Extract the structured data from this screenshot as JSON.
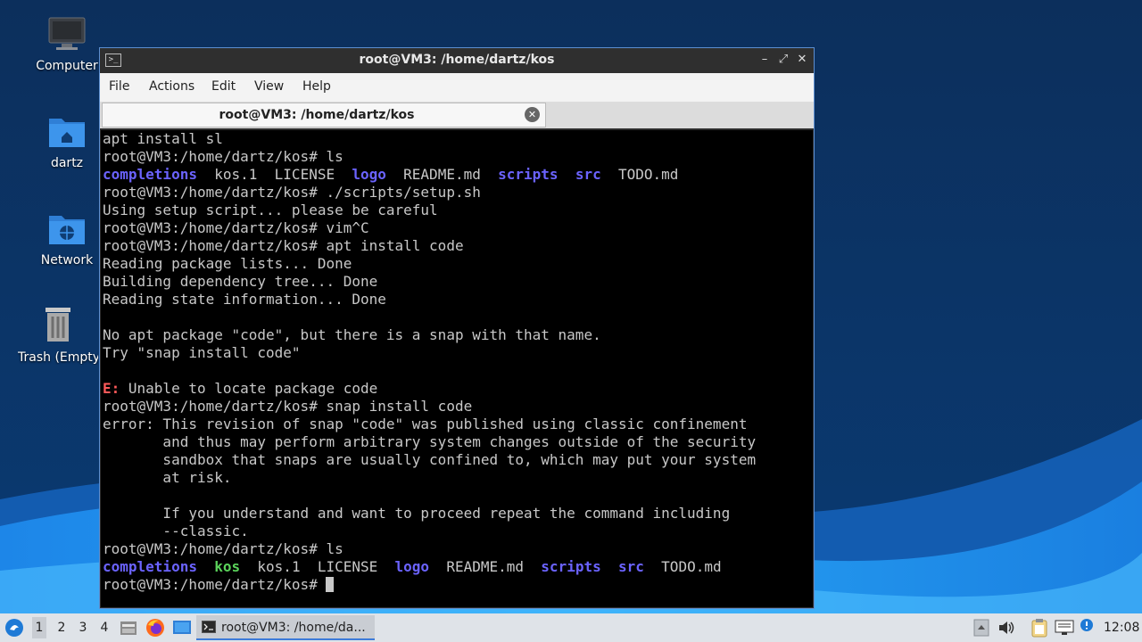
{
  "desktop": {
    "icons": [
      {
        "label": "Computer",
        "icon": "computer-icon"
      },
      {
        "label": "dartz",
        "icon": "home-folder-icon"
      },
      {
        "label": "Network",
        "icon": "network-folder-icon"
      },
      {
        "label": "Trash (Empty)",
        "icon": "trash-icon"
      }
    ]
  },
  "window": {
    "title": "root@VM3: /home/dartz/kos",
    "controls": {
      "minimize": "–",
      "maximize": "⤢",
      "close": "✕"
    },
    "menu": [
      "File",
      "Actions",
      "Edit",
      "View",
      "Help"
    ],
    "tab": {
      "title": "root@VM3: /home/dartz/kos",
      "close": "✕"
    }
  },
  "terminal": {
    "colors": {
      "fg": "#c8c8c8",
      "dir": "#6b63ff",
      "exec": "#5ad25a",
      "error": "#ff5a5a"
    },
    "lines": [
      [
        {
          "t": "apt install sl"
        }
      ],
      [
        {
          "t": "root@VM3:/home/dartz/kos# ls"
        }
      ],
      [
        {
          "t": "completions",
          "c": "dir"
        },
        {
          "t": "  kos.1  LICENSE  "
        },
        {
          "t": "logo",
          "c": "dir"
        },
        {
          "t": "  README.md  "
        },
        {
          "t": "scripts",
          "c": "dir"
        },
        {
          "t": "  "
        },
        {
          "t": "src",
          "c": "dir"
        },
        {
          "t": "  TODO.md"
        }
      ],
      [
        {
          "t": "root@VM3:/home/dartz/kos# ./scripts/setup.sh"
        }
      ],
      [
        {
          "t": "Using setup script... please be careful"
        }
      ],
      [
        {
          "t": "root@VM3:/home/dartz/kos# vim^C"
        }
      ],
      [
        {
          "t": "root@VM3:/home/dartz/kos# apt install code"
        }
      ],
      [
        {
          "t": "Reading package lists... Done"
        }
      ],
      [
        {
          "t": "Building dependency tree... Done"
        }
      ],
      [
        {
          "t": "Reading state information... Done"
        }
      ],
      [
        {
          "t": ""
        }
      ],
      [
        {
          "t": "No apt package \"code\", but there is a snap with that name."
        }
      ],
      [
        {
          "t": "Try \"snap install code\""
        }
      ],
      [
        {
          "t": ""
        }
      ],
      [
        {
          "t": "E:",
          "c": "err"
        },
        {
          "t": " Unable to locate package code"
        }
      ],
      [
        {
          "t": "root@VM3:/home/dartz/kos# snap install code"
        }
      ],
      [
        {
          "t": "error: This revision of snap \"code\" was published using classic confinement"
        }
      ],
      [
        {
          "t": "       and thus may perform arbitrary system changes outside of the security"
        }
      ],
      [
        {
          "t": "       sandbox that snaps are usually confined to, which may put your system"
        }
      ],
      [
        {
          "t": "       at risk."
        }
      ],
      [
        {
          "t": ""
        }
      ],
      [
        {
          "t": "       If you understand and want to proceed repeat the command including"
        }
      ],
      [
        {
          "t": "       --classic."
        }
      ],
      [
        {
          "t": "root@VM3:/home/dartz/kos# ls"
        }
      ],
      [
        {
          "t": "completions",
          "c": "dir"
        },
        {
          "t": "  "
        },
        {
          "t": "kos",
          "c": "exe"
        },
        {
          "t": "  kos.1  LICENSE  "
        },
        {
          "t": "logo",
          "c": "dir"
        },
        {
          "t": "  README.md  "
        },
        {
          "t": "scripts",
          "c": "dir"
        },
        {
          "t": "  "
        },
        {
          "t": "src",
          "c": "dir"
        },
        {
          "t": "  TODO.md"
        }
      ],
      [
        {
          "t": "root@VM3:/home/dartz/kos# "
        },
        {
          "t": "",
          "c": "cursor"
        }
      ]
    ]
  },
  "taskbar": {
    "workspaces": [
      "1",
      "2",
      "3",
      "4"
    ],
    "active_workspace": "1",
    "launchers": [
      "file-manager-icon",
      "firefox-icon",
      "desktop-icon"
    ],
    "task": {
      "title": "root@VM3: /home/da...",
      "icon": "terminal-icon"
    },
    "tray": [
      "tray-arrow-icon",
      "volume-icon",
      "clipboard-icon",
      "network-icon",
      "update-icon"
    ],
    "clock": "12:08"
  }
}
